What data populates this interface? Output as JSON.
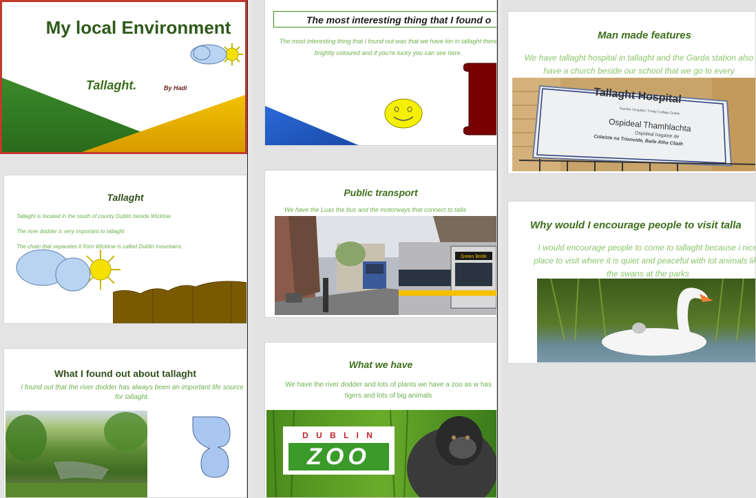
{
  "slides": {
    "title_slide": {
      "title": "My local Environment",
      "subtitle": "Tallaght.",
      "byline": "By Hadi"
    },
    "tallaght": {
      "title": "Tallaght",
      "lines": [
        "Tallaght is located in the south of county Dublin beside Wicklow",
        "The river dodder is very important to tallaght",
        "The chain that separates it from Wicklow is called Dublin mountains."
      ]
    },
    "found_out": {
      "title": "What I found out about tallaght",
      "text": "I found out that the river dodder has always been an important life source for tallaght."
    },
    "interesting": {
      "title": "The most interesting thing that I found o",
      "text": "The most interesting thing that I found out was that we have kin in tallaght there brightly coloured and if you're lucky you can see here."
    },
    "transport": {
      "title": "Public transport",
      "text": "We have the Luas the bus and the motorways that connect to talla",
      "tram_sign": "Green Bride"
    },
    "what_we_have": {
      "title": "What we have",
      "text": "We have the river dodder and lots of plants we have a zoo as w has tigers and lots of big animals",
      "zoo_logo_top": "D U B L I N",
      "zoo_logo_word": "ZOO"
    },
    "man_made": {
      "title": "Man made features",
      "text": "We have tallaght hospital in tallaght and the Garda station also have a church beside our school that we go to every",
      "sign_title": "Tallaght Hospital",
      "sign_sub": "Teacher Hospital / Trinity College Dublin",
      "sign_irish": "Ospideal Thamhlachta",
      "sign_irish2": "Ospideal Iragaise de",
      "sign_irish3": "Colaiste na Trionoide, Baile Atha Cliath"
    },
    "why_visit": {
      "title": "Why would I encourage people to visit talla",
      "text": "I would encourage people to come to tallaght because i nice place to visit where it is quiet and peaceful with lot animals like the swans at the parks"
    }
  },
  "colors": {
    "title_green": "#3c6e1c",
    "text_green": "#6ab04a",
    "slide_border_red": "#c0392b"
  }
}
